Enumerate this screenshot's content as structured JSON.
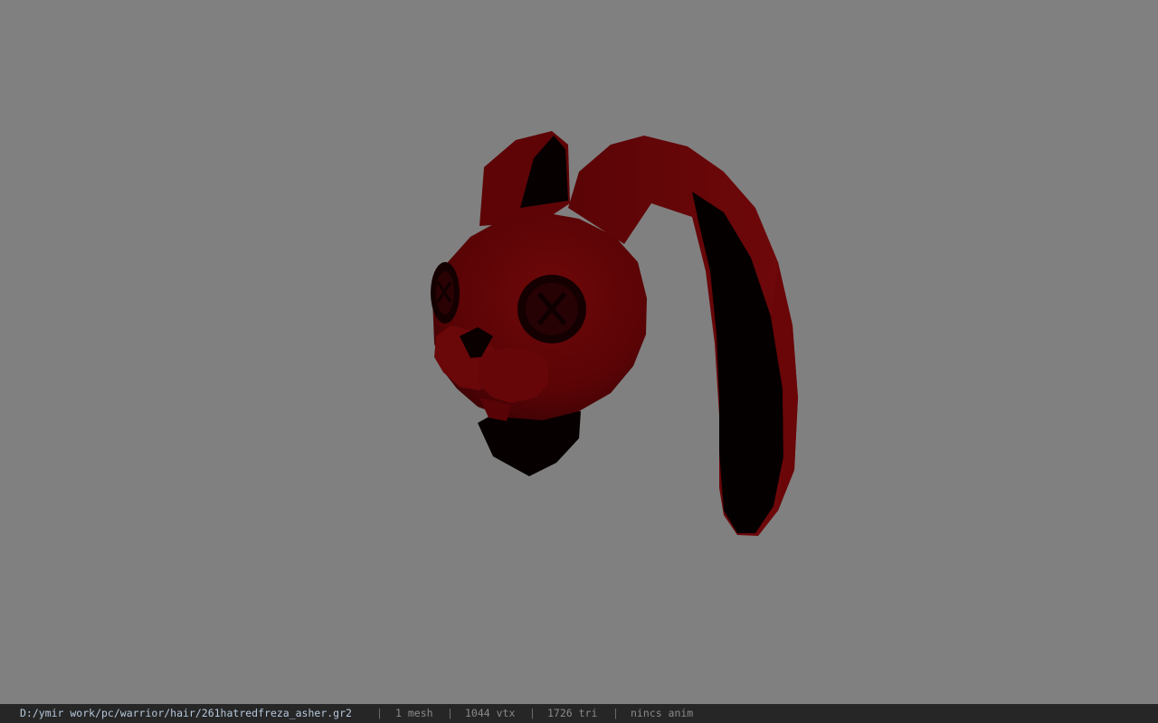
{
  "viewer": {
    "background_color": "#808080",
    "model_icon": "bunny-ears-hat-model",
    "model_colors": {
      "fabric": "#6a0508",
      "fabric_dark": "#3a0204",
      "inner": "#050000"
    }
  },
  "status_bar": {
    "file_path": "D:/ymir work/pc/warrior/hair/261hatredfreza_asher.gr2",
    "separator": "|",
    "mesh_count": "1 mesh",
    "vertex_count": "1044 vtx",
    "triangle_count": "1726 tri",
    "anim_info": "nincs anim",
    "bar_color": "#262626",
    "path_color": "#b6c8dc",
    "text_color": "#8a8a8a"
  }
}
